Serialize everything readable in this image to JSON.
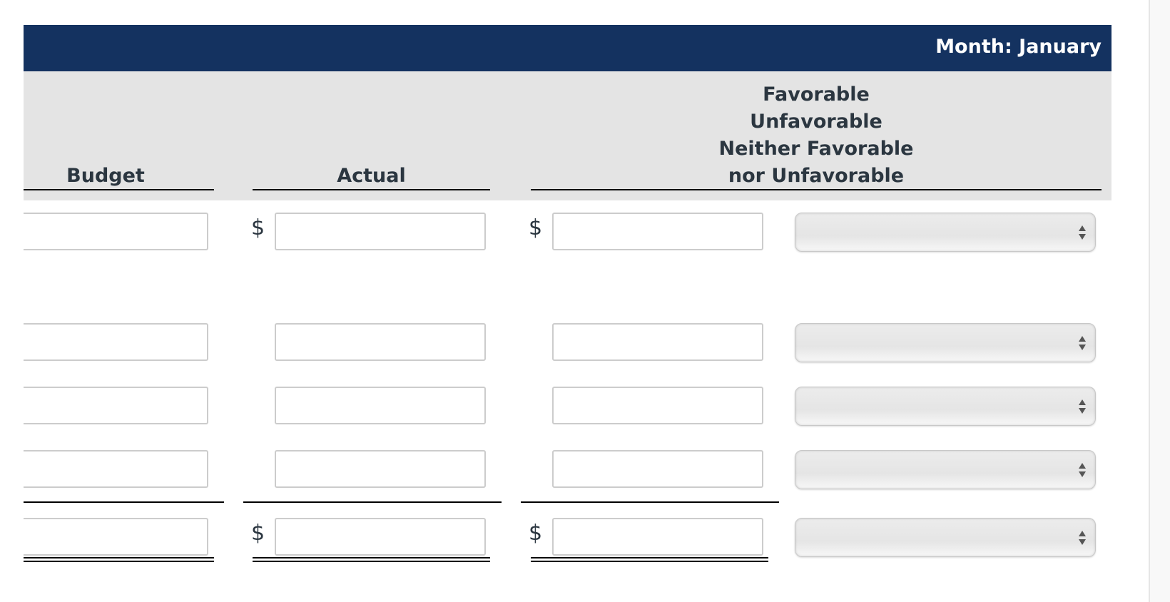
{
  "header": {
    "title": "Month: January"
  },
  "columns": {
    "budget": "Budget",
    "actual": "Actual",
    "variance_lines": [
      "Favorable",
      "Unfavorable",
      "Neither Favorable",
      "nor Unfavorable"
    ]
  },
  "currency_symbol": "$",
  "rows": [
    {
      "budget": "",
      "actual": "",
      "variance": "",
      "status": ""
    },
    {
      "budget": "",
      "actual": "",
      "variance": "",
      "status": ""
    },
    {
      "budget": "",
      "actual": "",
      "variance": "",
      "status": ""
    },
    {
      "budget": "",
      "actual": "",
      "variance": "",
      "status": ""
    },
    {
      "budget": "",
      "actual": "",
      "variance": "",
      "status": ""
    }
  ],
  "icons": {
    "select_arrows": "up-down-arrows-icon"
  }
}
